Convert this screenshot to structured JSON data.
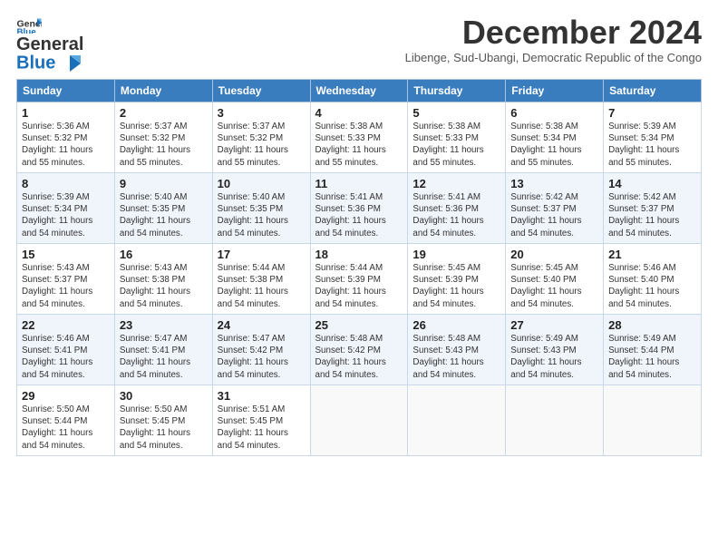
{
  "logo": {
    "general": "General",
    "blue": "Blue"
  },
  "title": "December 2024",
  "subtitle": "Libenge, Sud-Ubangi, Democratic Republic of the Congo",
  "headers": [
    "Sunday",
    "Monday",
    "Tuesday",
    "Wednesday",
    "Thursday",
    "Friday",
    "Saturday"
  ],
  "weeks": [
    [
      {
        "day": "1",
        "sunrise": "Sunrise: 5:36 AM",
        "sunset": "Sunset: 5:32 PM",
        "daylight": "Daylight: 11 hours and 55 minutes."
      },
      {
        "day": "2",
        "sunrise": "Sunrise: 5:37 AM",
        "sunset": "Sunset: 5:32 PM",
        "daylight": "Daylight: 11 hours and 55 minutes."
      },
      {
        "day": "3",
        "sunrise": "Sunrise: 5:37 AM",
        "sunset": "Sunset: 5:32 PM",
        "daylight": "Daylight: 11 hours and 55 minutes."
      },
      {
        "day": "4",
        "sunrise": "Sunrise: 5:38 AM",
        "sunset": "Sunset: 5:33 PM",
        "daylight": "Daylight: 11 hours and 55 minutes."
      },
      {
        "day": "5",
        "sunrise": "Sunrise: 5:38 AM",
        "sunset": "Sunset: 5:33 PM",
        "daylight": "Daylight: 11 hours and 55 minutes."
      },
      {
        "day": "6",
        "sunrise": "Sunrise: 5:38 AM",
        "sunset": "Sunset: 5:34 PM",
        "daylight": "Daylight: 11 hours and 55 minutes."
      },
      {
        "day": "7",
        "sunrise": "Sunrise: 5:39 AM",
        "sunset": "Sunset: 5:34 PM",
        "daylight": "Daylight: 11 hours and 55 minutes."
      }
    ],
    [
      {
        "day": "8",
        "sunrise": "Sunrise: 5:39 AM",
        "sunset": "Sunset: 5:34 PM",
        "daylight": "Daylight: 11 hours and 54 minutes."
      },
      {
        "day": "9",
        "sunrise": "Sunrise: 5:40 AM",
        "sunset": "Sunset: 5:35 PM",
        "daylight": "Daylight: 11 hours and 54 minutes."
      },
      {
        "day": "10",
        "sunrise": "Sunrise: 5:40 AM",
        "sunset": "Sunset: 5:35 PM",
        "daylight": "Daylight: 11 hours and 54 minutes."
      },
      {
        "day": "11",
        "sunrise": "Sunrise: 5:41 AM",
        "sunset": "Sunset: 5:36 PM",
        "daylight": "Daylight: 11 hours and 54 minutes."
      },
      {
        "day": "12",
        "sunrise": "Sunrise: 5:41 AM",
        "sunset": "Sunset: 5:36 PM",
        "daylight": "Daylight: 11 hours and 54 minutes."
      },
      {
        "day": "13",
        "sunrise": "Sunrise: 5:42 AM",
        "sunset": "Sunset: 5:37 PM",
        "daylight": "Daylight: 11 hours and 54 minutes."
      },
      {
        "day": "14",
        "sunrise": "Sunrise: 5:42 AM",
        "sunset": "Sunset: 5:37 PM",
        "daylight": "Daylight: 11 hours and 54 minutes."
      }
    ],
    [
      {
        "day": "15",
        "sunrise": "Sunrise: 5:43 AM",
        "sunset": "Sunset: 5:37 PM",
        "daylight": "Daylight: 11 hours and 54 minutes."
      },
      {
        "day": "16",
        "sunrise": "Sunrise: 5:43 AM",
        "sunset": "Sunset: 5:38 PM",
        "daylight": "Daylight: 11 hours and 54 minutes."
      },
      {
        "day": "17",
        "sunrise": "Sunrise: 5:44 AM",
        "sunset": "Sunset: 5:38 PM",
        "daylight": "Daylight: 11 hours and 54 minutes."
      },
      {
        "day": "18",
        "sunrise": "Sunrise: 5:44 AM",
        "sunset": "Sunset: 5:39 PM",
        "daylight": "Daylight: 11 hours and 54 minutes."
      },
      {
        "day": "19",
        "sunrise": "Sunrise: 5:45 AM",
        "sunset": "Sunset: 5:39 PM",
        "daylight": "Daylight: 11 hours and 54 minutes."
      },
      {
        "day": "20",
        "sunrise": "Sunrise: 5:45 AM",
        "sunset": "Sunset: 5:40 PM",
        "daylight": "Daylight: 11 hours and 54 minutes."
      },
      {
        "day": "21",
        "sunrise": "Sunrise: 5:46 AM",
        "sunset": "Sunset: 5:40 PM",
        "daylight": "Daylight: 11 hours and 54 minutes."
      }
    ],
    [
      {
        "day": "22",
        "sunrise": "Sunrise: 5:46 AM",
        "sunset": "Sunset: 5:41 PM",
        "daylight": "Daylight: 11 hours and 54 minutes."
      },
      {
        "day": "23",
        "sunrise": "Sunrise: 5:47 AM",
        "sunset": "Sunset: 5:41 PM",
        "daylight": "Daylight: 11 hours and 54 minutes."
      },
      {
        "day": "24",
        "sunrise": "Sunrise: 5:47 AM",
        "sunset": "Sunset: 5:42 PM",
        "daylight": "Daylight: 11 hours and 54 minutes."
      },
      {
        "day": "25",
        "sunrise": "Sunrise: 5:48 AM",
        "sunset": "Sunset: 5:42 PM",
        "daylight": "Daylight: 11 hours and 54 minutes."
      },
      {
        "day": "26",
        "sunrise": "Sunrise: 5:48 AM",
        "sunset": "Sunset: 5:43 PM",
        "daylight": "Daylight: 11 hours and 54 minutes."
      },
      {
        "day": "27",
        "sunrise": "Sunrise: 5:49 AM",
        "sunset": "Sunset: 5:43 PM",
        "daylight": "Daylight: 11 hours and 54 minutes."
      },
      {
        "day": "28",
        "sunrise": "Sunrise: 5:49 AM",
        "sunset": "Sunset: 5:44 PM",
        "daylight": "Daylight: 11 hours and 54 minutes."
      }
    ],
    [
      {
        "day": "29",
        "sunrise": "Sunrise: 5:50 AM",
        "sunset": "Sunset: 5:44 PM",
        "daylight": "Daylight: 11 hours and 54 minutes."
      },
      {
        "day": "30",
        "sunrise": "Sunrise: 5:50 AM",
        "sunset": "Sunset: 5:45 PM",
        "daylight": "Daylight: 11 hours and 54 minutes."
      },
      {
        "day": "31",
        "sunrise": "Sunrise: 5:51 AM",
        "sunset": "Sunset: 5:45 PM",
        "daylight": "Daylight: 11 hours and 54 minutes."
      },
      null,
      null,
      null,
      null
    ]
  ]
}
